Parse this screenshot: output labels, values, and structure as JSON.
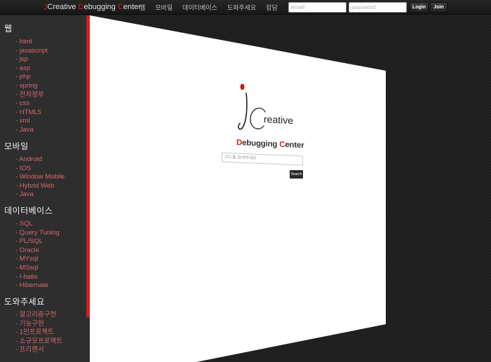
{
  "brand": {
    "part1": "J",
    "part2": "Creative ",
    "part3": "D",
    "part4": "ebugging ",
    "part5": "C",
    "part6": "enter"
  },
  "nav": [
    "웹",
    "모바일",
    "데이터베이스",
    "도와주세요",
    "잡담"
  ],
  "login": {
    "email_placeholder": "email",
    "password_placeholder": "password",
    "login_label": "Login",
    "join_label": "Join"
  },
  "sidebar": {
    "sections": [
      {
        "title": "웹",
        "items": [
          "- html",
          "- javascript",
          "- jsp",
          "- asp",
          "- php",
          "- spring",
          "- 전자정부",
          "- css",
          "- HTML5",
          "- xml",
          "- Java"
        ]
      },
      {
        "title": "모바일",
        "items": [
          "- Android",
          "- IOS",
          "- Window Mobile",
          "- Hybrid Web",
          "- Java"
        ]
      },
      {
        "title": "데이터베이스",
        "items": [
          "- SQL",
          "- Query Tuning",
          "- PL/SQL",
          "- Oracle",
          "- MYsql",
          "- MSsql",
          "- I-batis",
          "- Hibernate"
        ]
      },
      {
        "title": "도와주세요",
        "items": [
          "- 알고리즘구현",
          "- 기능구현",
          "- 1인프로젝트",
          "- 소규모프로젝트",
          "- 프리랜서"
        ]
      }
    ]
  },
  "main": {
    "logo_word": "reative",
    "title": {
      "d": "D",
      "ebugging": "ebugging ",
      "c": "C",
      "enter": "enter"
    },
    "search_placeholder": "코드를 검색하세요",
    "search_button": "Search"
  },
  "colors": {
    "accent": "#d81c1c",
    "link": "#d76a6a",
    "sidebar_bg": "#2e2e2e"
  }
}
